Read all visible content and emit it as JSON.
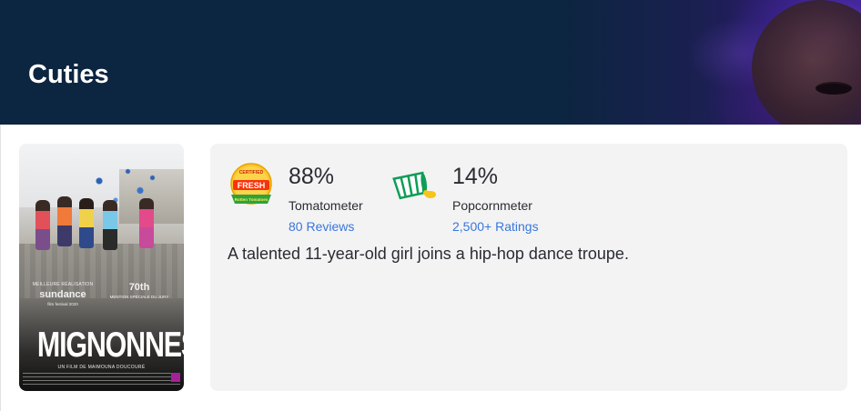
{
  "header": {
    "title": "Cuties"
  },
  "poster": {
    "laurel_left_top": "MEILLEURE RÉALISATION",
    "laurel_left_name": "sundance",
    "laurel_left_sub": "film festival 2020",
    "laurel_right_num": "70th",
    "laurel_right_sub": "MENTION SPÉCIALE DU JURY",
    "title": "MIGNONNES",
    "credit": "UN FILM DE MAIMOUNA DOUCOURÉ"
  },
  "scores": {
    "tomatometer": {
      "icon": "certified-fresh-icon",
      "badge_top": "CERTIFIED",
      "badge_mid": "FRESH",
      "badge_bottom": "Rotten Tomatoes",
      "value": "88%",
      "label": "Tomatometer",
      "link": "80 Reviews"
    },
    "popcornmeter": {
      "icon": "spilled-popcorn-icon",
      "value": "14%",
      "label": "Popcornmeter",
      "link": "2,500+ Ratings"
    }
  },
  "synopsis": "A talented 11-year-old girl joins a hip-hop dance troupe.",
  "colors": {
    "header_bg": "#0c2540",
    "panel_bg": "#f3f3f3",
    "link": "#3976dc",
    "fresh_red": "#fa320a",
    "popcorn_green": "#0f9d58",
    "popcorn_yellow": "#f5c518"
  }
}
